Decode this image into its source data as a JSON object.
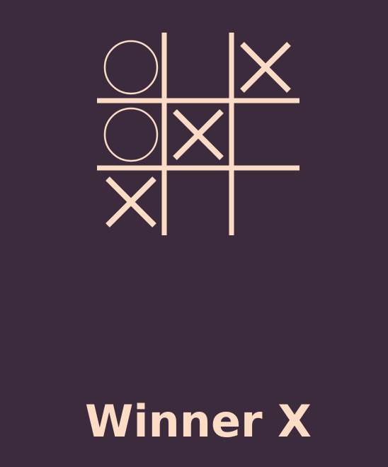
{
  "game": {
    "board": [
      [
        "O",
        "",
        "X"
      ],
      [
        "O",
        "X",
        ""
      ],
      [
        "X",
        "",
        ""
      ]
    ],
    "status_text": "Winner X"
  },
  "colors": {
    "background": "#3b2b3c",
    "foreground": "#fcdcc4"
  },
  "icons": {
    "x_mark": "x-icon",
    "o_mark": "o-icon"
  }
}
